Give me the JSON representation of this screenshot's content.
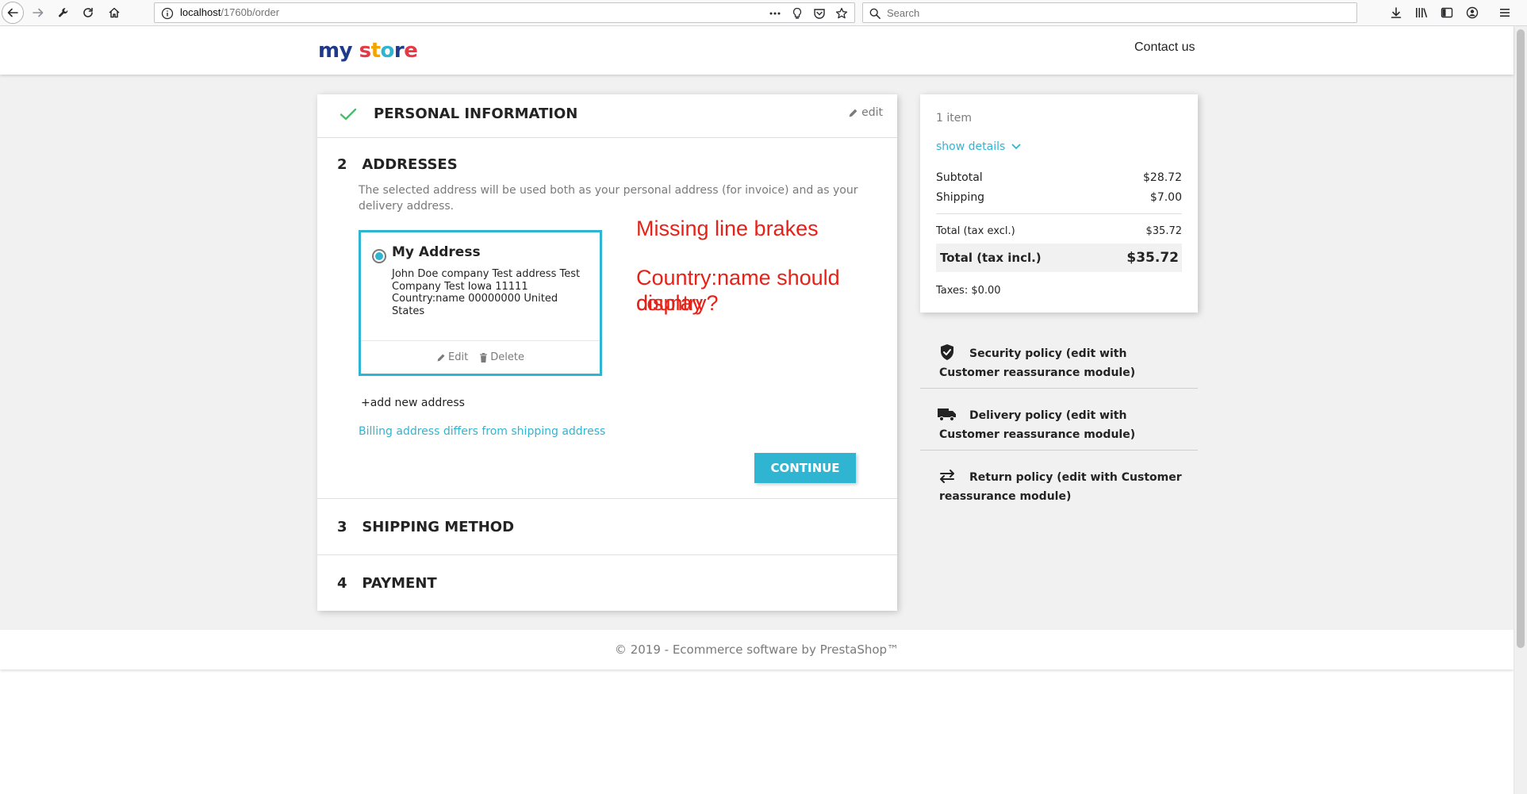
{
  "browser": {
    "url_host": "localhost",
    "url_path": "/1760b/order",
    "search_placeholder": "Search"
  },
  "header": {
    "logo_word1": "my",
    "logo_word2": "store",
    "contact_label": "Contact us",
    "logo_colors": [
      "#1f3a8a",
      "#e63946",
      "#f4a300",
      "#2fb5d2"
    ]
  },
  "steps": {
    "personal": {
      "title": "PERSONAL INFORMATION",
      "edit_label": "edit",
      "check_color": "#4cbb6c"
    },
    "addresses": {
      "number": "2",
      "title": "ADDRESSES",
      "description": "The selected address will be used both as your personal address (for invoice) and as your delivery address.",
      "card": {
        "alias": "My Address",
        "text": "John Doe company Test address Test Company Test Iowa 11111 Country:name 00000000 United States",
        "edit_label": "Edit",
        "delete_label": "Delete"
      },
      "add_address_label": "+add new address",
      "billing_link": "Billing address differs from shipping address",
      "continue_label": "CONTINUE"
    },
    "shipping": {
      "number": "3",
      "title": "SHIPPING METHOD"
    },
    "payment": {
      "number": "4",
      "title": "PAYMENT"
    }
  },
  "cart": {
    "items_count": "1 item",
    "show_details": "show details",
    "subtotal_label": "Subtotal",
    "subtotal_value": "$28.72",
    "shipping_label": "Shipping",
    "shipping_value": "$7.00",
    "total_excl_label": "Total (tax excl.)",
    "total_excl_value": "$35.72",
    "total_incl_label": "Total (tax incl.)",
    "total_incl_value": "$35.72",
    "taxes": "Taxes: $0.00"
  },
  "reassurance": [
    {
      "icon": "shield-check-icon",
      "text": "Security policy (edit with Customer reassurance module)"
    },
    {
      "icon": "truck-icon",
      "text": "Delivery policy (edit with Customer reassurance module)"
    },
    {
      "icon": "swap-arrows-icon",
      "text": "Return policy (edit with Customer reassurance module)"
    }
  ],
  "annotations": {
    "line1": "Missing line brakes",
    "line2": "Country:name should display",
    "line3": "country?",
    "color": "#e62117"
  },
  "footer": {
    "copyright": "© 2019 - Ecommerce software by PrestaShop™"
  },
  "accent_color": "#2fb5d2"
}
